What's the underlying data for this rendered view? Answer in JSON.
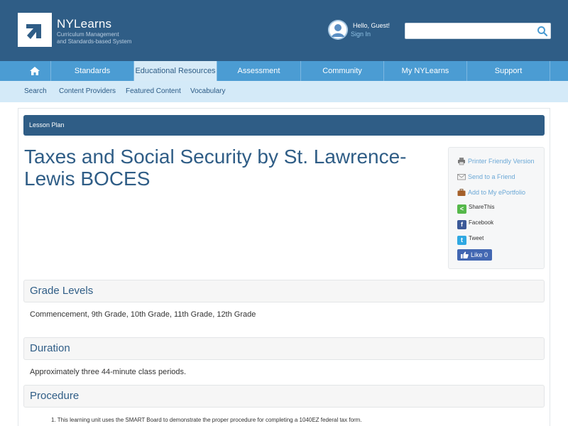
{
  "header": {
    "logo_title": "NYLearns",
    "logo_sub_line1": "Curriculum Management",
    "logo_sub_line2": "and Standards-based System",
    "greeting": "Hello, Guest!",
    "sign_in": "Sign In",
    "search_value": "",
    "search_placeholder": ""
  },
  "mainnav": {
    "home_icon": "home-icon",
    "items": [
      {
        "label": "Standards"
      },
      {
        "label": "Educational Resources"
      },
      {
        "label": "Assessment"
      },
      {
        "label": "Community"
      },
      {
        "label": "My NYLearns"
      },
      {
        "label": "Support"
      }
    ],
    "active": "Educational Resources"
  },
  "subnav": {
    "items": [
      {
        "label": "Search"
      },
      {
        "label": "Content Providers"
      },
      {
        "label": "Featured Content"
      },
      {
        "label": "Vocabulary"
      }
    ]
  },
  "content": {
    "breadcrumb_bar": "Lesson Plan",
    "title": "Taxes and Social Security by St. Lawrence-Lewis BOCES",
    "side": {
      "printer": "Printer Friendly Version",
      "send": "Send to a Friend",
      "portfolio": "Add to My ePortfolio",
      "sharethis": "ShareThis",
      "facebook": "Facebook",
      "tweet": "Tweet",
      "like": "Like 0"
    },
    "grade_levels_heading": "Grade Levels",
    "grade_levels_text": "Commencement, 9th Grade, 10th Grade, 11th Grade, 12th Grade",
    "duration_heading": "Duration",
    "duration_text": "Approximately three 44-minute class periods.",
    "procedure_heading": "Procedure",
    "procedure_items": [
      "1.  This learning unit uses the SMART Board to demonstrate the proper procedure for completing a 1040EZ federal tax form."
    ]
  },
  "colors": {
    "header_bg": "#2f5d86",
    "nav_bg": "#4b9cd3",
    "subnav_bg": "#d4eaf8",
    "accent_text": "#2f5d86",
    "link": "#6ba8d6"
  }
}
